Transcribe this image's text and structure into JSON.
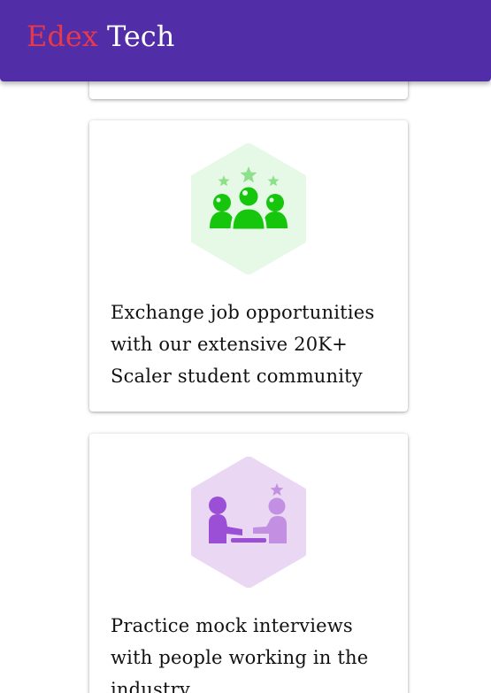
{
  "appbar": {
    "brand_first": "Edex",
    "brand_second": "Tech",
    "background_color": "#512DA8",
    "brand_first_color": "#e8394a"
  },
  "cards": [
    {
      "icon": "community-icon",
      "icon_color": "#16c60c",
      "icon_bg": "#e6f9e6",
      "text": "Exchange job opportunities with our extensive 20K+ Scaler student community"
    },
    {
      "icon": "mock-interview-icon",
      "icon_color": "#9b4fd6",
      "icon_bg": "#ead7f3",
      "text": "Practice mock interviews with people working in the industry"
    }
  ]
}
